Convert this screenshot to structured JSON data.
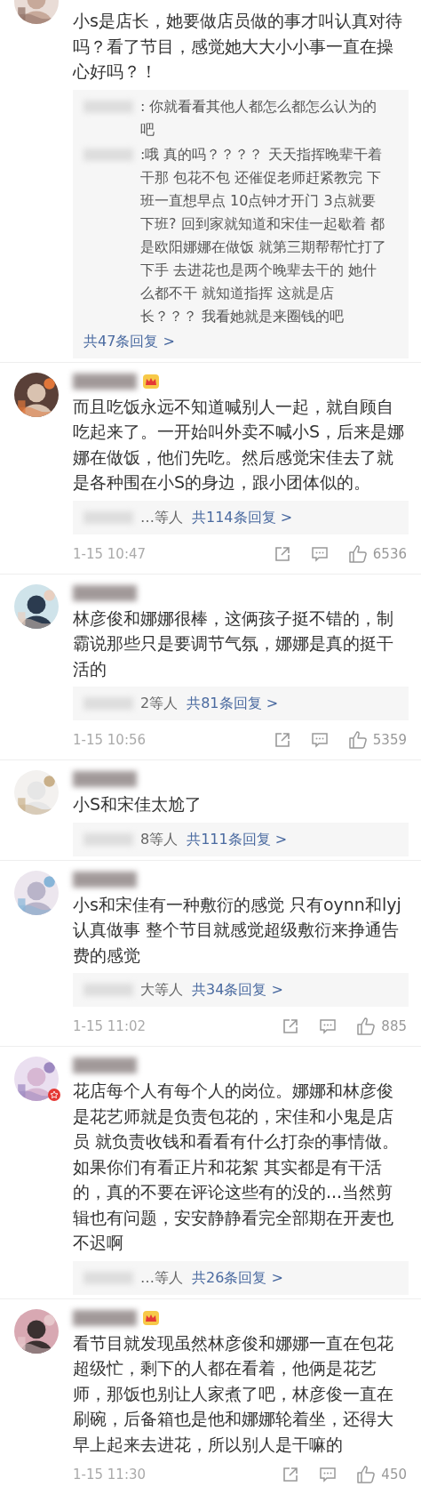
{
  "comments": [
    {
      "vip": false,
      "avatar_badge": false,
      "show_name": false,
      "text": "小s是店长，她要做店员做的事才叫认真对待吗？看了节目，感觉她大大小小事一直在操心好吗？！",
      "replies": [
        {
          "text": ": 你就看看其他人都怎么都怎么认为的吧"
        },
        {
          "text": ":哦 真的吗？？？？ 天天指挥晚辈干着干那 包花不包 还催促老师赶紧教完 下班一直想早点 10点钟才开门 3点就要下班? 回到家就知道和宋佳一起歇着 都是欧阳娜娜在做饭 就第三期帮帮忙打了下手 去进花也是两个晚辈去干的 她什么都不干 就知道指挥 这就是店长？？？ 我看她就是来圈钱的吧"
        }
      ],
      "reply_summary": {
        "count": "共47条回复 >"
      }
    },
    {
      "vip": true,
      "avatar_badge": false,
      "show_name": true,
      "text": "而且吃饭永远不知道喊别人一起，就自顾自吃起来了。一开始叫外卖不喊小S，后来是娜娜在做饭，他们先吃。然后感觉宋佳去了就是各种围在小S的身边，跟小团体似的。",
      "reply_summary": {
        "names": "…等人",
        "count": "共114条回复 >"
      },
      "time": "1-15 10:47",
      "likes": "6536"
    },
    {
      "vip": false,
      "avatar_badge": false,
      "show_name": true,
      "text": "林彦俊和娜娜很棒，这俩孩子挺不错的，制霸说那些只是要调节气氛，娜娜是真的挺干活的",
      "reply_summary": {
        "names": "2等人",
        "count": "共81条回复 >"
      },
      "time": "1-15 10:56",
      "likes": "5359"
    },
    {
      "vip": false,
      "avatar_badge": false,
      "show_name": true,
      "text": "小S和宋佳太尬了",
      "reply_summary": {
        "names": "8等人",
        "count": "共111条回复 >"
      }
    },
    {
      "vip": false,
      "avatar_badge": false,
      "show_name": true,
      "text": "小s和宋佳有一种敷衍的感觉 只有oynn和lyj认真做事 整个节目就感觉超级敷衍来挣通告费的感觉",
      "reply_summary": {
        "names": "大等人",
        "count": "共34条回复 >"
      },
      "time": "1-15 11:02",
      "likes": "885"
    },
    {
      "vip": false,
      "avatar_badge": true,
      "show_name": true,
      "text": "花店每个人有每个人的岗位。娜娜和林彦俊是花艺师就是负责包花的，宋佳和小鬼是店员  就负责收钱和看看有什么打杂的事情做。如果你们有看正片和花絮 其实都是有干活的，真的不要在评论这些有的没的...当然剪辑也有问题，安安静静看完全部期在开麦也不迟啊",
      "reply_summary": {
        "names": "…等人",
        "count": "共26条回复 >"
      }
    },
    {
      "vip": true,
      "avatar_badge": false,
      "show_name": true,
      "text": "看节目就发现虽然林彦俊和娜娜一直在包花超级忙，剩下的人都在看着，他俩是花艺师，那饭也别让人家煮了吧，林彦俊一直在刷碗，后备箱也是他和娜娜轮着坐，还得大早上起来去进花，所以别人是干嘛的",
      "time": "1-15 11:30",
      "likes": "450"
    }
  ]
}
